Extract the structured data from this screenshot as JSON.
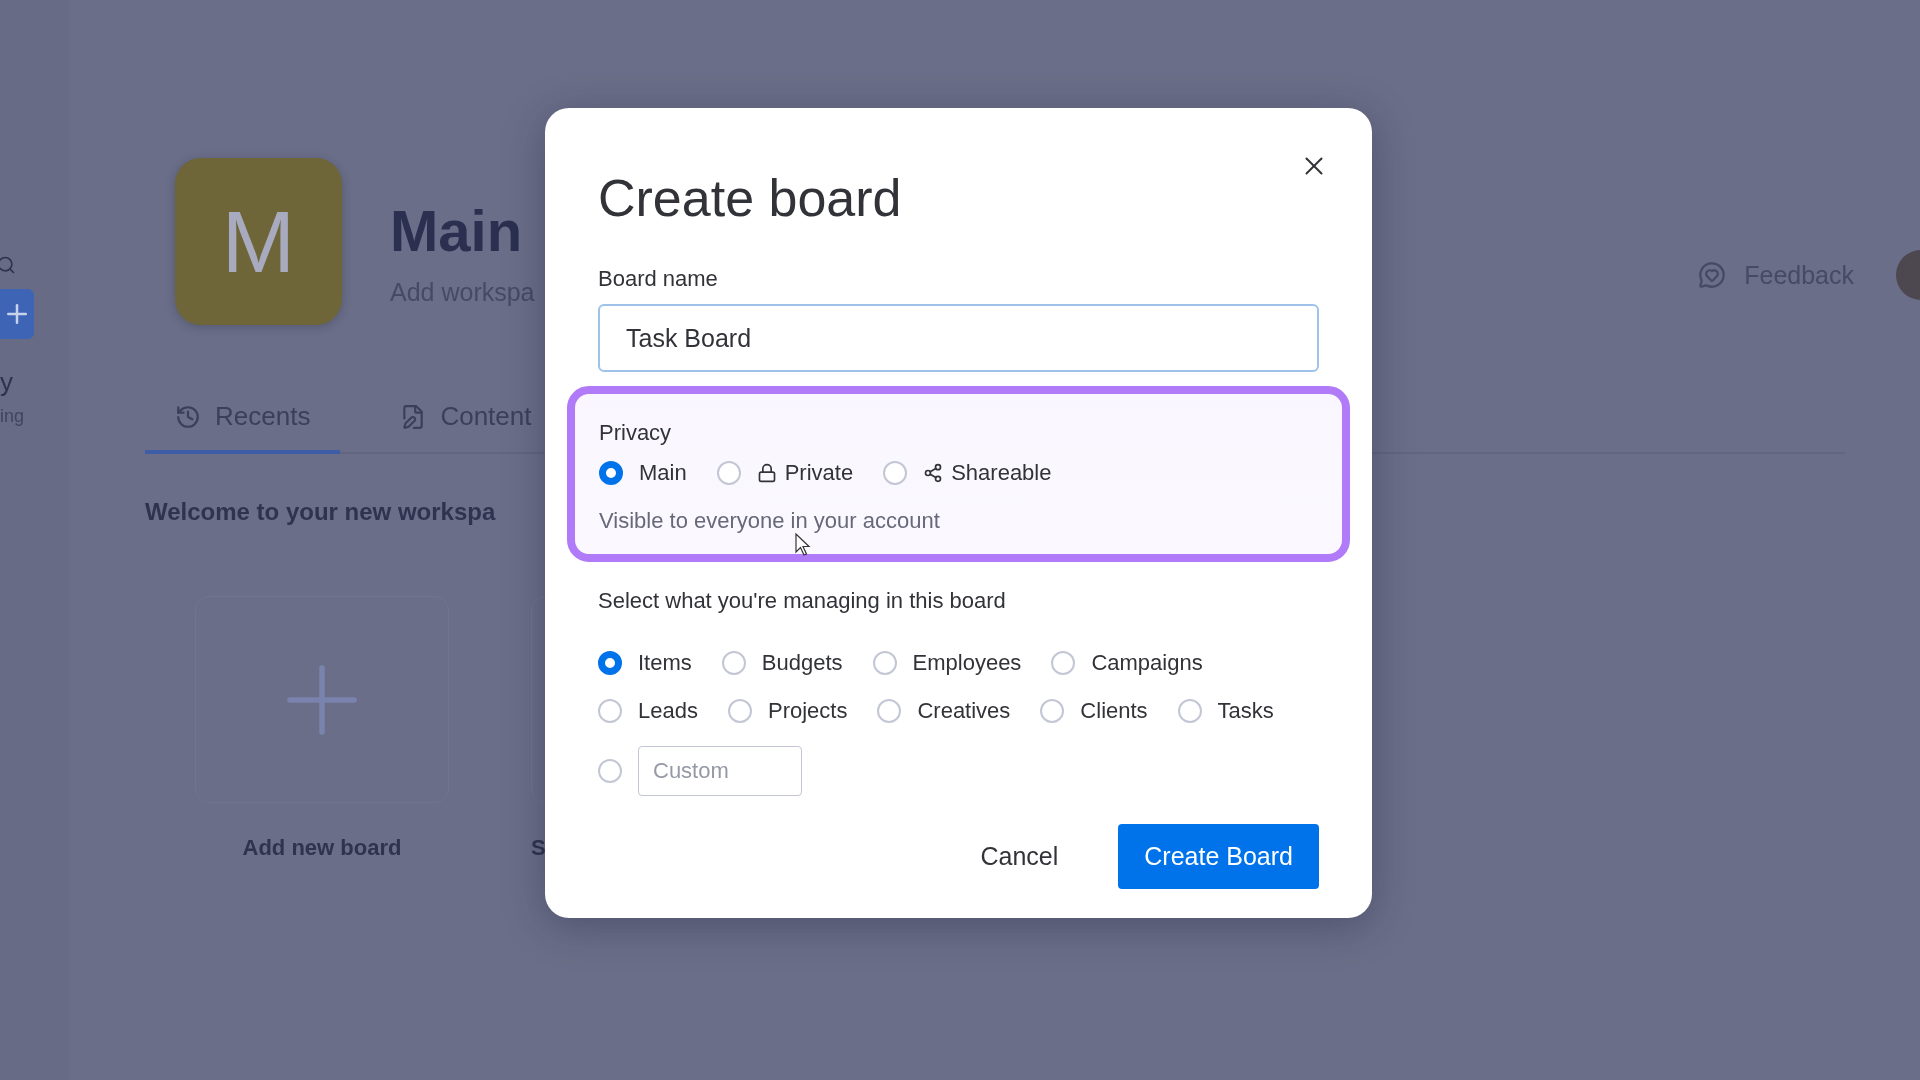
{
  "sidebar": {
    "texts": [
      "y",
      "ing"
    ]
  },
  "workspace": {
    "avatar_letter": "M",
    "title": "Main",
    "description": "Add workspa"
  },
  "header": {
    "feedback": "Feedback"
  },
  "tabs": [
    {
      "label": "Recents",
      "selected": true
    },
    {
      "label": "Content",
      "selected": false
    }
  ],
  "welcome": "Welcome to your new workspa",
  "cards": [
    {
      "label": "Add new board",
      "kind": "add"
    },
    {
      "label": "S",
      "kind": "board"
    }
  ],
  "dialog": {
    "title": "Create board",
    "board_name": {
      "label": "Board name",
      "value": "Task Board"
    },
    "privacy": {
      "label": "Privacy",
      "highlighted": true,
      "options": [
        {
          "label": "Main",
          "selected": true
        },
        {
          "label": "Private",
          "selected": false
        },
        {
          "label": "Shareable",
          "selected": false
        }
      ],
      "hint": "Visible to everyone in your account"
    },
    "managing": {
      "label": "Select what you're managing in this board",
      "rows": [
        {
          "options": [
            {
              "label": "Items",
              "selected": true
            },
            {
              "label": "Budgets",
              "selected": false
            },
            {
              "label": "Employees",
              "selected": false
            },
            {
              "label": "Campaigns",
              "selected": false
            }
          ]
        },
        {
          "options": [
            {
              "label": "Leads",
              "selected": false
            },
            {
              "label": "Projects",
              "selected": false
            },
            {
              "label": "Creatives",
              "selected": false
            },
            {
              "label": "Clients",
              "selected": false
            },
            {
              "label": "Tasks",
              "selected": false
            }
          ]
        }
      ],
      "custom": {
        "placeholder": "Custom",
        "selected": false
      }
    },
    "buttons": [
      {
        "label": "Cancel",
        "kind": "secondary"
      },
      {
        "label": "Create Board",
        "kind": "primary"
      }
    ]
  }
}
